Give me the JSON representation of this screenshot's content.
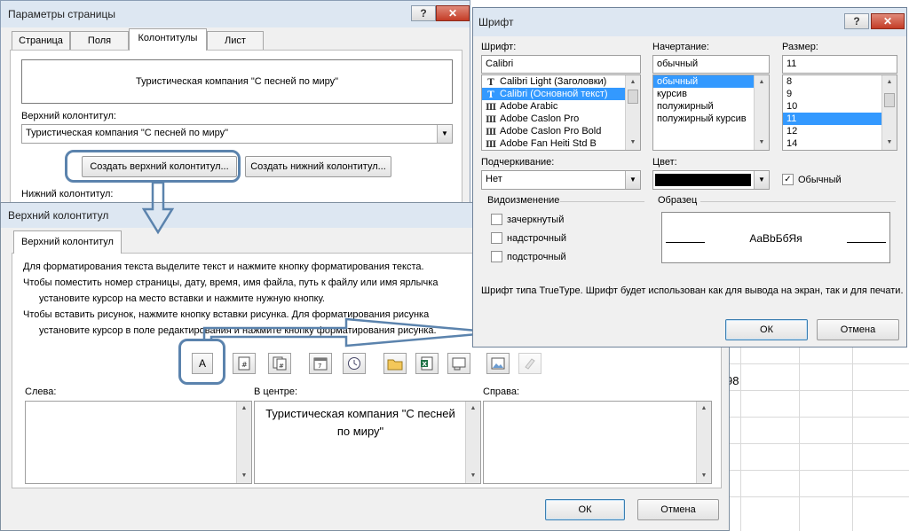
{
  "colors": {
    "callout": "#5b83ad",
    "selection": "#3399ff",
    "titlebar": "#dde7f2"
  },
  "page_setup": {
    "title": "Параметры страницы",
    "help": "?",
    "close": "✕",
    "tabs": [
      "Страница",
      "Поля",
      "Колонтитулы",
      "Лист"
    ],
    "preview_text": "Туристическая компания \"С песней по миру\"",
    "header_label": "Верхний колонтитул:",
    "header_value": "Туристическая компания \"С песней по миру\"",
    "create_header_btn": "Создать верхний колонтитул...",
    "create_footer_btn": "Создать нижний колонтитул...",
    "footer_label": "Нижний колонтитул:"
  },
  "header_dialog": {
    "title": "Верхний колонтитул",
    "tab": "Верхний колонтитул",
    "instructions": [
      "Для форматирования текста выделите текст и нажмите кнопку форматирования текста.",
      "Чтобы поместить номер страницы, дату, время, имя файла, путь к файлу или имя ярлычка",
      "установите курсор на место вставки и нажмите нужную кнопку.",
      "Чтобы вставить рисунок, нажмите кнопку вставки рисунка.  Для форматирования рисунка",
      "установите курсор в поле редактирования и нажмите кнопку форматирования рисунка."
    ],
    "format_text_btn": "A",
    "left_label": "Слева:",
    "center_label": "В центре:",
    "right_label": "Справа:",
    "center_text": "Туристическая компания \"С песней по миру\"",
    "ok": "ОК",
    "cancel": "Отмена"
  },
  "font_dialog": {
    "title": "Шрифт",
    "help": "?",
    "close": "✕",
    "font_label": "Шрифт:",
    "font_value": "Calibri",
    "font_list": [
      "Calibri Light (Заголовки)",
      "Calibri (Основной текст)",
      "Adobe Arabic",
      "Adobe Caslon Pro",
      "Adobe Caslon Pro Bold",
      "Adobe Fan Heiti Std B"
    ],
    "font_selected": 1,
    "style_label": "Начертание:",
    "style_value": "обычный",
    "style_list": [
      "обычный",
      "курсив",
      "полужирный",
      "полужирный курсив"
    ],
    "style_selected": 0,
    "size_label": "Размер:",
    "size_value": "11",
    "size_list": [
      "8",
      "9",
      "10",
      "11",
      "12",
      "14"
    ],
    "size_selected": 3,
    "underline_label": "Подчеркивание:",
    "underline_value": "Нет",
    "color_label": "Цвет:",
    "color_value": "#000000",
    "normal_label": "Обычный",
    "normal_checked": true,
    "effects_label": "Видоизменение",
    "effects": [
      "зачеркнутый",
      "надстрочный",
      "подстрочный"
    ],
    "sample_label": "Образец",
    "sample_text": "AaBbБбЯя",
    "note": "Шрифт типа TrueType. Шрифт будет использован как для вывода на экран, так и для печати.",
    "ok": "ОК",
    "cancel": "Отмена"
  },
  "sheet": {
    "cell_value": "98"
  }
}
